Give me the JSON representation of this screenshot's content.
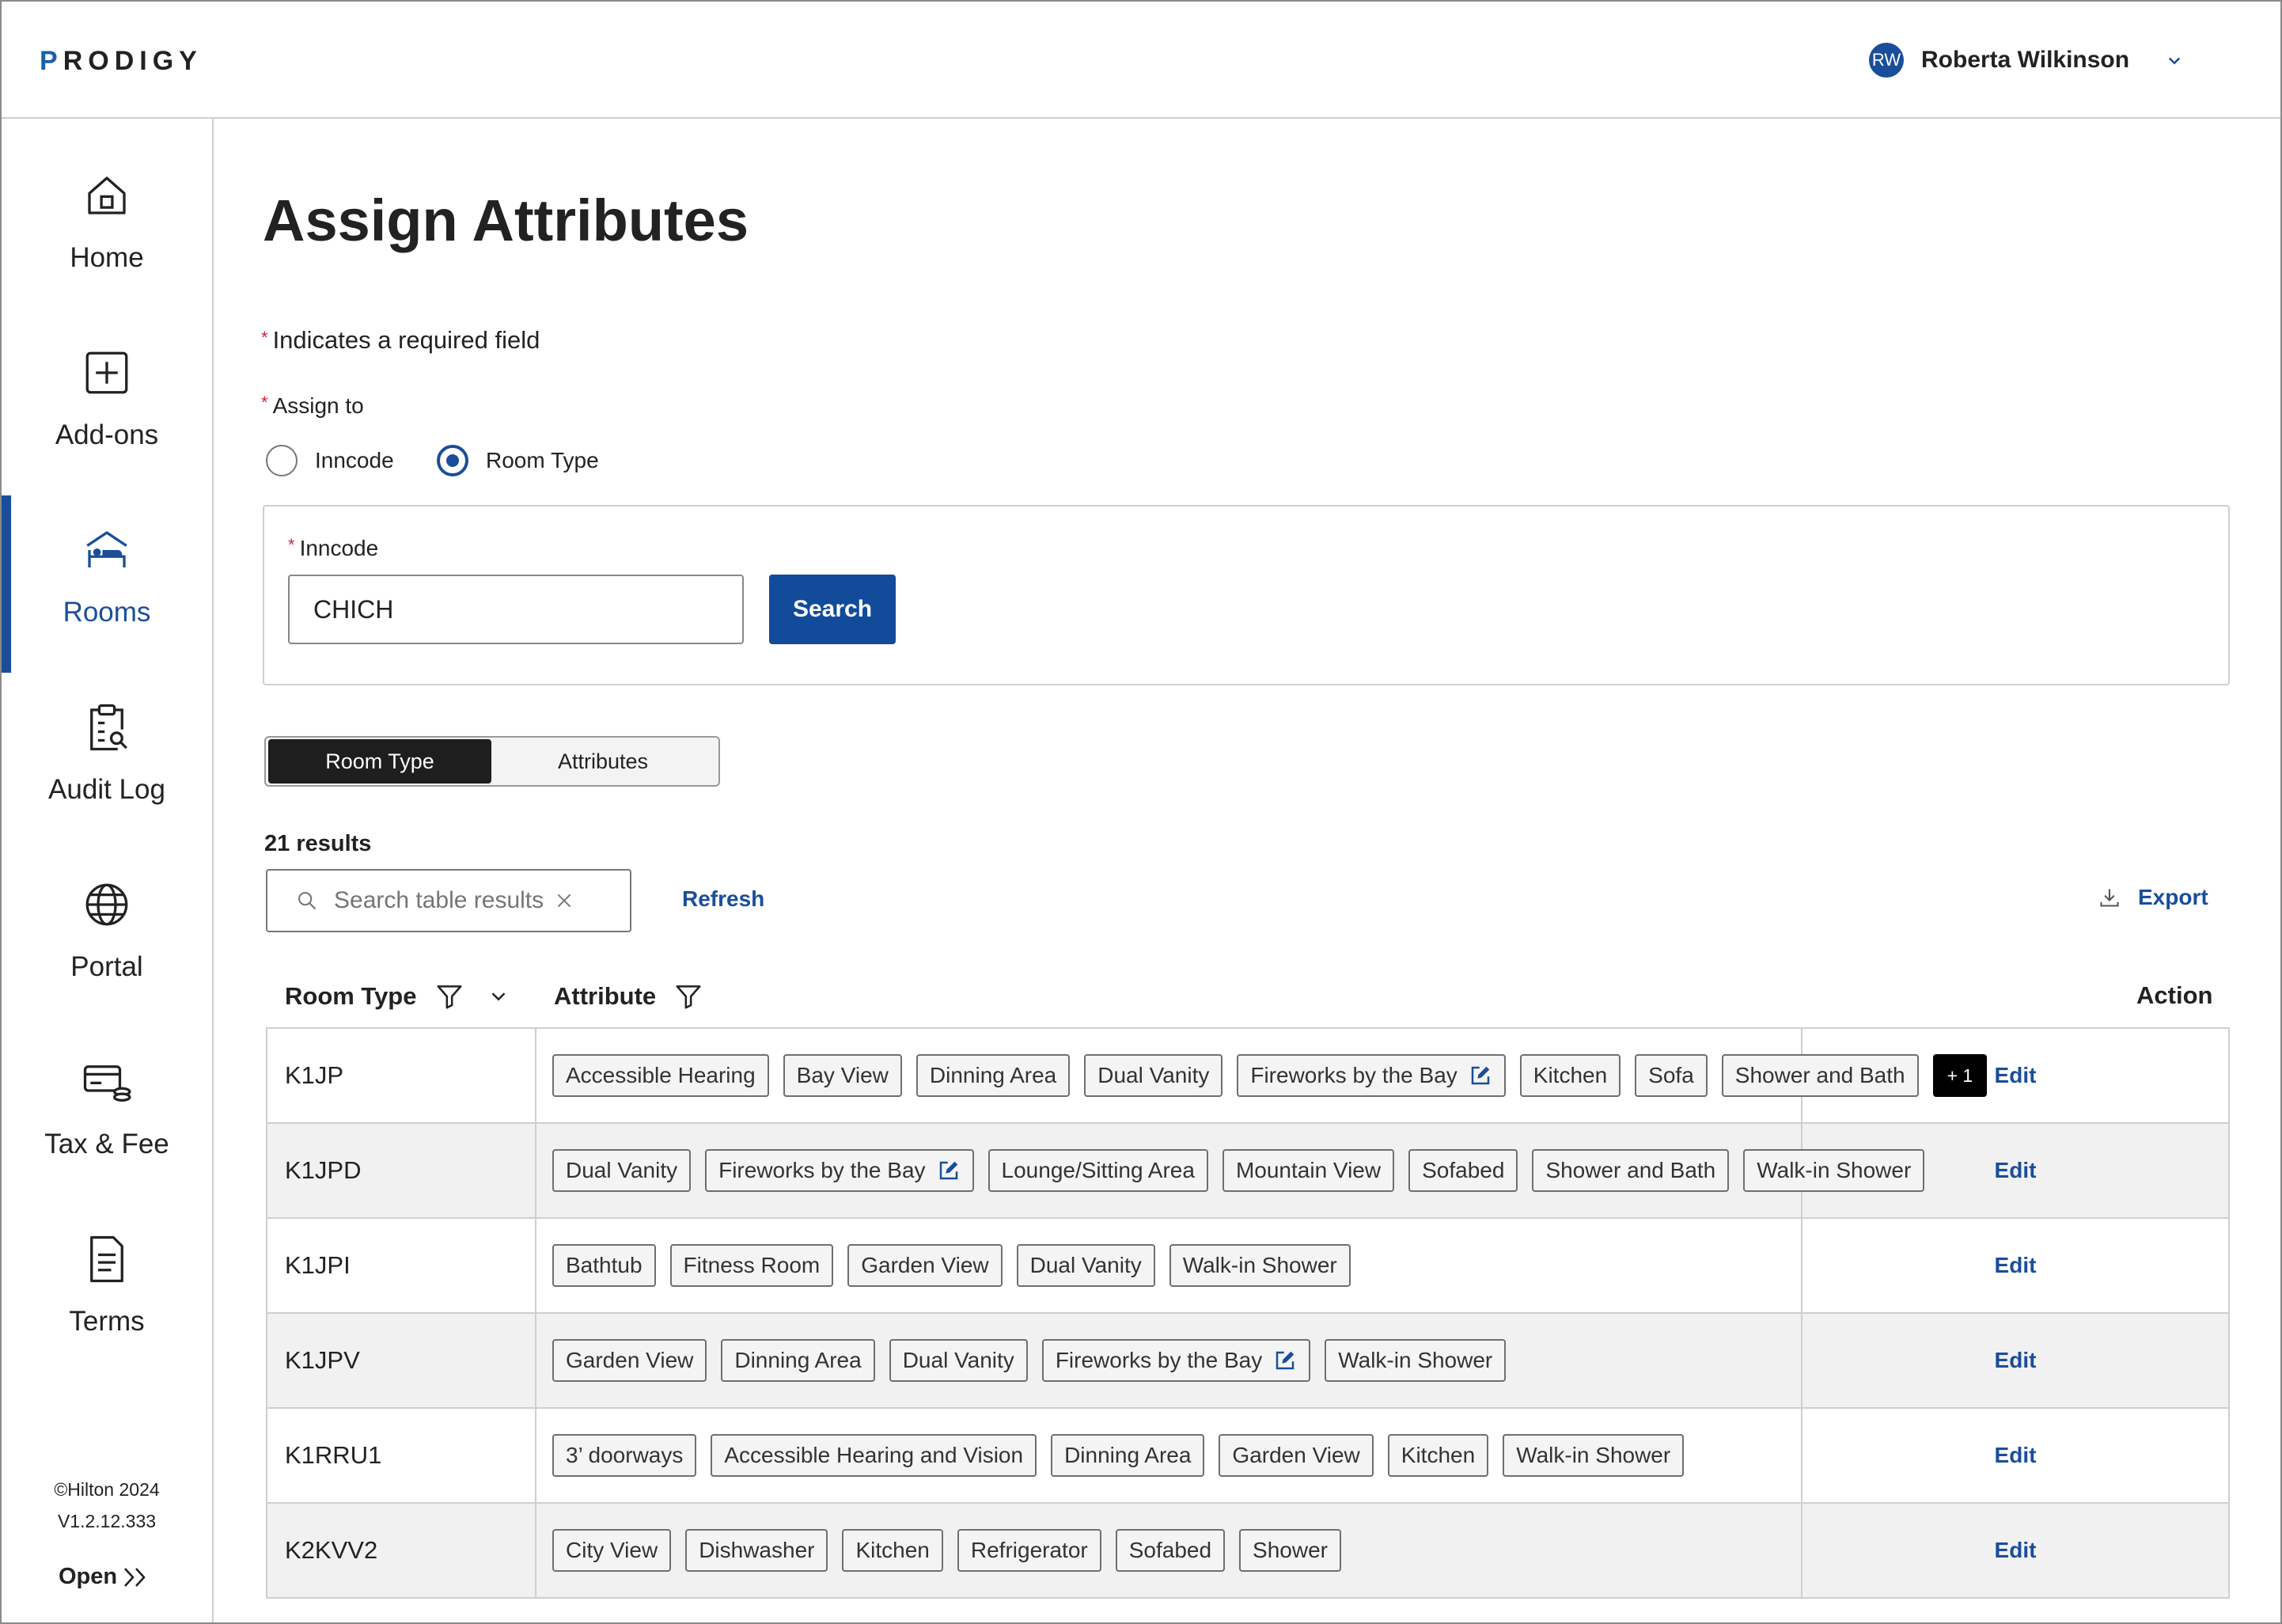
{
  "app": {
    "logo_first": "P",
    "logo_rest": "RODIGY"
  },
  "user": {
    "initials": "RW",
    "name": "Roberta Wilkinson"
  },
  "sidebar": {
    "items": [
      {
        "label": "Home",
        "icon": "home-icon"
      },
      {
        "label": "Add-ons",
        "icon": "plus-square-icon"
      },
      {
        "label": "Rooms",
        "icon": "bed-icon",
        "active": true
      },
      {
        "label": "Audit Log",
        "icon": "clipboard-search-icon"
      },
      {
        "label": "Portal",
        "icon": "globe-icon"
      },
      {
        "label": "Tax & Fee",
        "icon": "card-coins-icon"
      },
      {
        "label": "Terms",
        "icon": "document-icon"
      }
    ],
    "copyright": "©Hilton 2024",
    "version": "V1.2.12.333",
    "open_label": "Open"
  },
  "page": {
    "title": "Assign Attributes",
    "required_note": "Indicates a required field",
    "assign_to_label": "Assign to",
    "radio_inncode": "Inncode",
    "radio_roomtype": "Room Type",
    "selected": "Room Type"
  },
  "search": {
    "inncode_label": "Inncode",
    "inncode_value": "CHICH",
    "button": "Search"
  },
  "view_toggle": {
    "room_type": "Room Type",
    "attributes": "Attributes",
    "selected": "Room Type"
  },
  "table_tools": {
    "results": "21 results",
    "search_placeholder": "Search table results",
    "refresh": "Refresh",
    "export": "Export"
  },
  "table": {
    "headers": {
      "room_type": "Room Type",
      "attribute": "Attribute",
      "action": "Action"
    },
    "rows": [
      {
        "room_type": "K1JP",
        "attributes": [
          "Accessible Hearing",
          "Bay View",
          "Dinning Area",
          "Dual Vanity",
          "Fireworks by the Bay",
          "Kitchen",
          "Sofa",
          "Shower and Bath"
        ],
        "editable_attribute": "Fireworks by the Bay",
        "more": "+ 1",
        "action": "Edit"
      },
      {
        "room_type": "K1JPD",
        "attributes": [
          "Dual Vanity",
          "Fireworks by the Bay",
          "Lounge/Sitting Area",
          "Mountain View",
          "Sofabed",
          "Shower and Bath",
          "Walk-in Shower"
        ],
        "editable_attribute": "Fireworks by the Bay",
        "action": "Edit"
      },
      {
        "room_type": "K1JPI",
        "attributes": [
          "Bathtub",
          "Fitness Room",
          "Garden View",
          "Dual Vanity",
          "Walk-in Shower"
        ],
        "action": "Edit"
      },
      {
        "room_type": "K1JPV",
        "attributes": [
          "Garden View",
          "Dinning Area",
          "Dual Vanity",
          "Fireworks by the Bay",
          "Walk-in Shower"
        ],
        "editable_attribute": "Fireworks by the Bay",
        "action": "Edit"
      },
      {
        "room_type": "K1RRU1",
        "attributes": [
          "3’ doorways",
          "Accessible Hearing and Vision",
          "Dinning Area",
          "Garden View",
          "Kitchen",
          "Walk-in Shower"
        ],
        "action": "Edit"
      },
      {
        "room_type": "K2KVV2",
        "attributes": [
          "City View",
          "Dishwasher",
          "Kitchen",
          "Refrigerator",
          "Sofabed",
          "Shower"
        ],
        "action": "Edit"
      }
    ]
  },
  "colors": {
    "accent": "#1a4e9a",
    "required": "#d4213d",
    "toggle_active": "#1e1e1e"
  }
}
